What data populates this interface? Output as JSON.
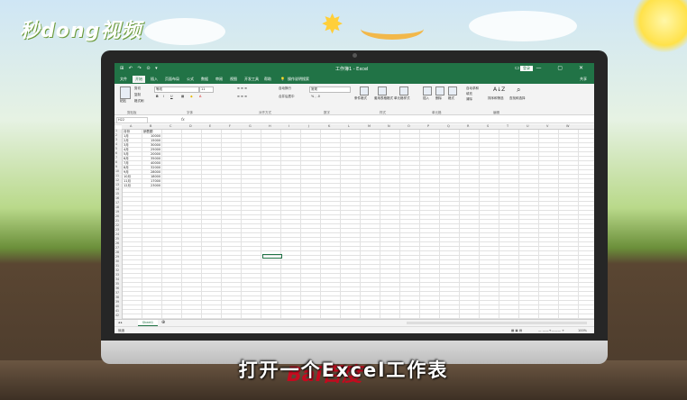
{
  "brand": {
    "logo_text": "秒dong视频"
  },
  "excel": {
    "window_title": "工作簿1 - Excel",
    "qat": "⊞ ↶ ↷ ⊙ ▾",
    "sign_in": "登录",
    "share": "共享",
    "tabs": [
      "文件",
      "开始",
      "插入",
      "页面布局",
      "公式",
      "数据",
      "审阅",
      "视图",
      "开发工具",
      "帮助"
    ],
    "tell_me": "操作说明搜索",
    "ribbon": {
      "paste": "粘贴",
      "cut": "剪切",
      "copy": "复制",
      "format_painter": "格式刷",
      "font_name": "等线",
      "font_size": "11",
      "wrap_text": "自动换行",
      "merge_center": "合并后居中",
      "number_format": "常规",
      "cond_format": "条件格式",
      "table_format": "套用表格格式",
      "cell_styles": "单元格样式",
      "insert": "插入",
      "delete": "删除",
      "format": "格式",
      "autosum": "自动求和",
      "fill": "填充",
      "clear": "清除",
      "sort_filter": "排序和筛选",
      "find_select": "查找和选择",
      "groups": [
        "剪贴板",
        "字体",
        "对齐方式",
        "数字",
        "样式",
        "单元格",
        "编辑"
      ]
    },
    "name_box": "H22",
    "fx": "fx",
    "columns": [
      "A",
      "B",
      "C",
      "D",
      "E",
      "F",
      "G",
      "H",
      "I",
      "J",
      "K",
      "L",
      "M",
      "N",
      "O",
      "P",
      "Q",
      "R",
      "S",
      "T",
      "U",
      "V",
      "W"
    ],
    "row_numbers": [
      "1",
      "2",
      "3",
      "4",
      "5",
      "6",
      "7",
      "8",
      "9",
      "10",
      "11",
      "12",
      "13",
      "14",
      "15",
      "16",
      "17",
      "18",
      "19",
      "20",
      "21",
      "22",
      "23",
      "24",
      "25",
      "26",
      "27",
      "28",
      "29",
      "30",
      "31",
      "32",
      "33",
      "34",
      "35",
      "36",
      "37",
      "38",
      "39",
      "40",
      "41",
      "42"
    ],
    "header_row": {
      "a": "月份",
      "b": "销售额"
    },
    "data_rows": [
      {
        "month": "1月",
        "sales": "10000"
      },
      {
        "month": "2月",
        "sales": "15000"
      },
      {
        "month": "3月",
        "sales": "30000"
      },
      {
        "month": "4月",
        "sales": "25000"
      },
      {
        "month": "5月",
        "sales": "20000"
      },
      {
        "month": "6月",
        "sales": "35000"
      },
      {
        "month": "7月",
        "sales": "40000"
      },
      {
        "month": "8月",
        "sales": "32000"
      },
      {
        "month": "9月",
        "sales": "28000"
      },
      {
        "month": "10月",
        "sales": "18000"
      },
      {
        "month": "11月",
        "sales": "17000"
      },
      {
        "month": "12月",
        "sales": "23000"
      }
    ],
    "sheet_tab": "Sheet1",
    "status": "就绪",
    "zoom": "100%"
  },
  "subtitle": "打开一个Excel工作表",
  "watermark": "Bai百度"
}
